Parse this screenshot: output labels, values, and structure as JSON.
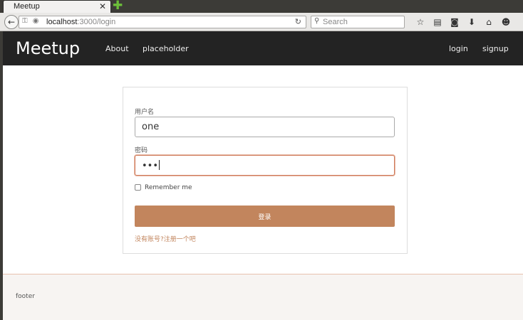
{
  "browser": {
    "tab_title": "Meetup",
    "tab_close": "✕",
    "new_tab": "✚",
    "back": "←",
    "url_host": "localhost",
    "url_path": ":3000/login",
    "reload": "↻",
    "search_icon": "🔍",
    "search_placeholder": "Search",
    "toolbar_icons": [
      "star-icon",
      "clipboard-icon",
      "pocket-icon",
      "download-icon",
      "home-icon",
      "chat-icon"
    ],
    "toolbar_glyphs": [
      "☆",
      "▤",
      "◙",
      "⬇",
      "⌂",
      "☻"
    ]
  },
  "header": {
    "brand": "Meetup",
    "nav_left": [
      "About",
      "placeholder"
    ],
    "nav_right": [
      "login",
      "signup"
    ]
  },
  "form": {
    "username_label": "用户名",
    "username_value": "one",
    "password_label": "密码",
    "password_value": "•••",
    "remember_label": "Remember me",
    "submit_label": "登录",
    "signup_link": "没有账号?注册一个吧"
  },
  "footer": {
    "text": "footer"
  },
  "colors": {
    "accent": "#c2855d",
    "header_bg": "#232323",
    "footer_bg": "#f7f4f2"
  }
}
